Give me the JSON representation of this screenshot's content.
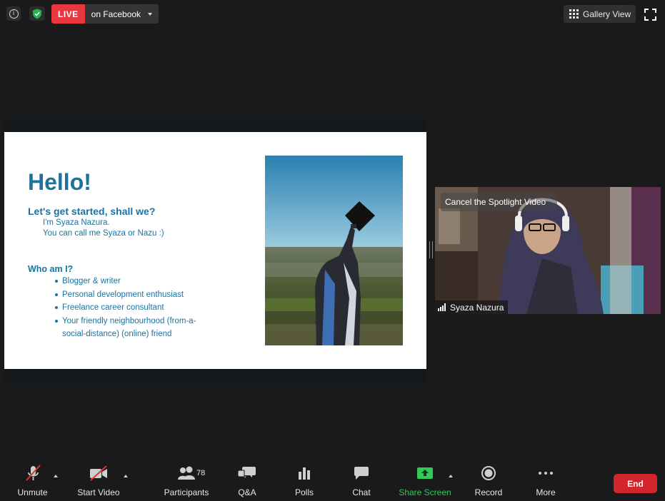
{
  "top_bar": {
    "info_glyph": "i",
    "live_badge": "LIVE",
    "live_target": "on Facebook",
    "gallery_view_label": "Gallery View",
    "colors": {
      "live": "#e8383e",
      "shield": "#23b44b"
    }
  },
  "slide": {
    "title": "Hello!",
    "subtitle": "Let's get started, shall we?",
    "intro_lines": [
      "I'm Syaza Nazura.",
      "You can call me Syaza or Nazu :)"
    ],
    "section_title": "Who am I?",
    "bullets": [
      "Blogger & writer",
      "Personal development enthusiast",
      "Freelance career consultant",
      "Your friendly neighbourhood (from-a-social-distance) (online) friend"
    ],
    "text_color": "#1a73a0"
  },
  "spotlight_video": {
    "cancel_label": "Cancel the Spotlight Video",
    "participant_name": "Syaza Nazura"
  },
  "toolbar": {
    "unmute": "Unmute",
    "start_video": "Start Video",
    "participants": "Participants",
    "participant_count": "78",
    "qa": "Q&A",
    "polls": "Polls",
    "chat": "Chat",
    "share_screen": "Share Screen",
    "record": "Record",
    "more": "More",
    "end": "End",
    "colors": {
      "share": "#32c85a",
      "end": "#d2262c",
      "muted_slash": "#e0332f"
    }
  }
}
